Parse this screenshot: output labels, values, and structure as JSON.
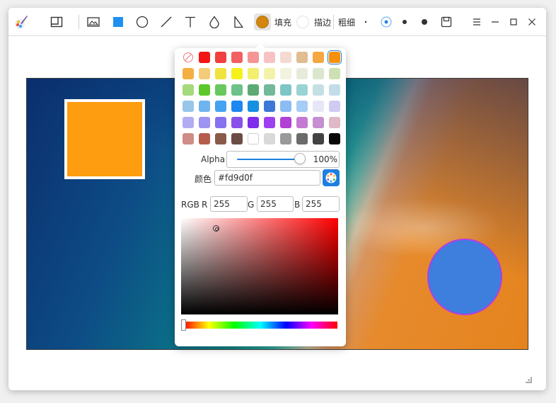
{
  "toolbar": {
    "fill_label": "填充",
    "stroke_label": "描边",
    "thickness_label": "粗细",
    "fill_color": "#d0860f"
  },
  "icons": {
    "app": "paintbrush-icon",
    "crop": "crop-icon",
    "image": "image-icon",
    "rectangle": "rectangle-icon",
    "ellipse": "ellipse-icon",
    "line": "line-icon",
    "text": "text-icon",
    "blur": "droplet-icon",
    "cut": "cut-icon",
    "save": "save-icon",
    "menu": "hamburger-menu-icon",
    "minimize": "minimize-icon",
    "maximize": "maximize-icon",
    "close": "close-icon",
    "eyedropper": "palette-picker-icon"
  },
  "palette": {
    "selected": "#f79009",
    "rows": [
      [
        "none",
        "#f21515",
        "#f33f3f",
        "#f26161",
        "#f59595",
        "#f8c2c2",
        "#f5dad2",
        "#e0bd93",
        "#f5a741",
        "#f79009"
      ],
      [
        "#f5ae41",
        "#f3cc77",
        "#f0e33d",
        "#f5f11a",
        "#f3ef6f",
        "#f3f2a9",
        "#f2f3de",
        "#e7ecda",
        "#dbe7cd",
        "#cde0b3"
      ],
      [
        "#a4d97c",
        "#5bc82a",
        "#68c85e",
        "#6cc288",
        "#5dab74",
        "#72b99a",
        "#7ec5c7",
        "#9ad3d4",
        "#c4e0e4",
        "#c2dde8"
      ],
      [
        "#97c6e9",
        "#6fb4ef",
        "#44a3f1",
        "#1e86f0",
        "#1790e2",
        "#3c78d8",
        "#8cbcf4",
        "#a6cdf5",
        "#e6e6f7",
        "#cfcbf3"
      ],
      [
        "#b2acf3",
        "#9c93f2",
        "#8671ee",
        "#8a51ea",
        "#7f2ceb",
        "#9e3ff0",
        "#b23fd6",
        "#c47ad2",
        "#c58fd2",
        "#dfb9c7"
      ],
      [
        "#d08c86",
        "#b65c4d",
        "#8a5a48",
        "#6b4d45",
        "#ffffff",
        "#d9d9d9",
        "#999999",
        "#6b6b6b",
        "#424242",
        "#080808"
      ]
    ]
  },
  "alpha": {
    "label": "Alpha",
    "value": "100%",
    "level": 1.0
  },
  "color": {
    "label": "颜色",
    "hex": "#fd9d0f"
  },
  "rgb": {
    "label": "RGB",
    "r_label": "R",
    "r": "255",
    "g_label": "G",
    "g": "255",
    "b_label": "B",
    "b": "255"
  },
  "shapes": {
    "rect_color": "#fd9d0f",
    "circle_fill": "#3e7fdd",
    "circle_stroke": "#b43be6"
  }
}
